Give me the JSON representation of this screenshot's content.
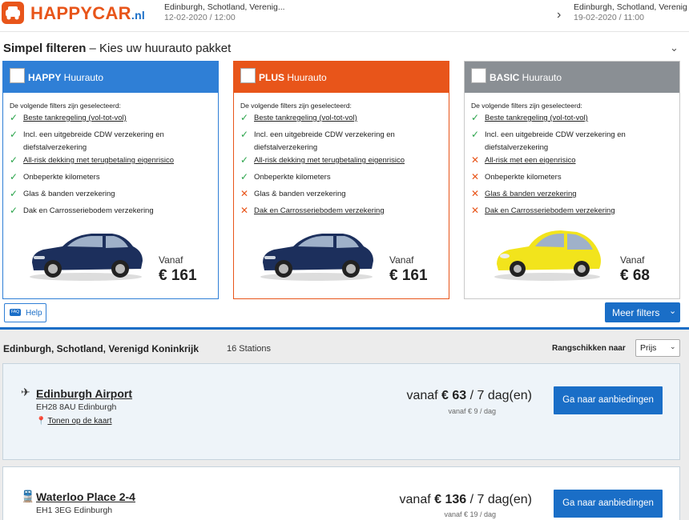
{
  "header": {
    "logo_text": "HAPPYCAR",
    "logo_suffix": ".nl",
    "pickup_location": "Edinburgh, Schotland, Verenig...",
    "pickup_date": "12-02-2020 / 12:00",
    "dropoff_location": "Edinburgh, Schotland, Verenig",
    "dropoff_date": "19-02-2020 / 11:00"
  },
  "filter": {
    "title_bold": "Simpel filteren",
    "title_rest": " – Kies uw huurauto pakket"
  },
  "packages": [
    {
      "name_bold": "HAPPY",
      "name_rest": " Huurauto",
      "intro": "De volgende filters zijn geselecteerd:",
      "features": [
        {
          "text": "Beste tankregeling (vol-tot-vol)",
          "included": true,
          "link": true
        },
        {
          "text": "Incl. een uitgebreide CDW verzekering en diefstalverzekering",
          "included": true,
          "link": false
        },
        {
          "text": "All-risk dekking met terugbetaling eigenrisico",
          "included": true,
          "link": true
        },
        {
          "text": "Onbeperkte kilometers",
          "included": true,
          "link": false
        },
        {
          "text": "Glas & banden verzekering",
          "included": true,
          "link": false
        },
        {
          "text": "Dak en Carrosseriebodem verzekering",
          "included": true,
          "link": false
        }
      ],
      "vanaf": "Vanaf",
      "price": "€ 161",
      "car": "dark-blue-hatchback"
    },
    {
      "name_bold": "PLUS",
      "name_rest": " Huurauto",
      "intro": "De volgende filters zijn geselecteerd:",
      "features": [
        {
          "text": "Beste tankregeling (vol-tot-vol)",
          "included": true,
          "link": true
        },
        {
          "text": "Incl. een uitgebreide CDW verzekering en diefstalverzekering",
          "included": true,
          "link": false
        },
        {
          "text": "All-risk dekking met terugbetaling eigenrisico",
          "included": true,
          "link": true
        },
        {
          "text": "Onbeperkte kilometers",
          "included": true,
          "link": false
        },
        {
          "text": "Glas & banden verzekering",
          "included": false,
          "link": false
        },
        {
          "text": "Dak en Carrosseriebodem verzekering",
          "included": false,
          "link": true
        }
      ],
      "vanaf": "Vanaf",
      "price": "€ 161",
      "car": "dark-blue-hatchback"
    },
    {
      "name_bold": "BASIC",
      "name_rest": " Huurauto",
      "intro": "De volgende filters zijn geselecteerd:",
      "features": [
        {
          "text": "Beste tankregeling (vol-tot-vol)",
          "included": true,
          "link": true
        },
        {
          "text": "Incl. een uitgebreide CDW verzekering en diefstalverzekering",
          "included": true,
          "link": false
        },
        {
          "text": "All-risk met een eigenrisico",
          "included": false,
          "link": true
        },
        {
          "text": "Onbeperkte kilometers",
          "included": false,
          "link": false
        },
        {
          "text": "Glas & banden verzekering",
          "included": false,
          "link": true
        },
        {
          "text": "Dak en Carrosseriebodem verzekering",
          "included": false,
          "link": true
        }
      ],
      "vanaf": "Vanaf",
      "price": "€ 68",
      "car": "yellow-city-car"
    }
  ],
  "help_label": "Help",
  "help_badge": "FAQ",
  "meer_filters": "Meer filters",
  "results": {
    "title": "Edinburgh, Schotland, Verenigd Koninkrijk",
    "count": "16 Stations",
    "sort_label": "Rangschikken naar",
    "sort_value": "Prijs"
  },
  "stations": [
    {
      "icon": "airplane-icon",
      "name": "Edinburgh Airport",
      "address": "EH28 8AU Edinburgh",
      "map_link": "Tonen op de kaart",
      "price_prefix": "vanaf ",
      "price": "€ 63",
      "price_suffix": " / 7 dag(en)",
      "per_day": "vanaf € 9 / dag",
      "button": "Ga naar aanbiedingen"
    },
    {
      "icon": "train-icon",
      "name": "Waterloo Place 2-4",
      "address": "EH1 3EG Edinburgh",
      "price_prefix": "vanaf ",
      "price": "€ 136",
      "price_suffix": " / 7 dag(en)",
      "per_day": "vanaf € 19 / dag",
      "button": "Ga naar aanbiedingen"
    }
  ],
  "colors": {
    "happy": "#2f7fd6",
    "plus": "#e8551a",
    "basic": "#8a8f94",
    "brand_orange": "#e8551a",
    "button_blue": "#1a6ec7",
    "check_green": "#2aa44a"
  }
}
